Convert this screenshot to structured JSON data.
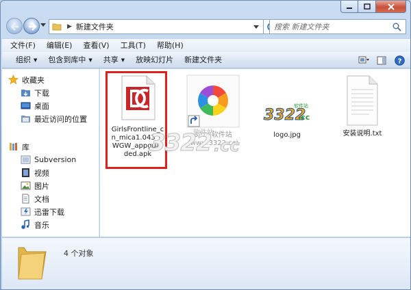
{
  "window": {
    "caption": {
      "minimize_icon": "minimize-icon",
      "maximize_icon": "maximize-icon",
      "close_icon": "close-icon"
    }
  },
  "address_bar": {
    "path": [
      "新建文件夹"
    ],
    "search_placeholder": "搜索 新建文件夹"
  },
  "menu": [
    "文件(F)",
    "编辑(E)",
    "查看(V)",
    "工具(T)",
    "帮助(H)"
  ],
  "toolbar": {
    "organize": "组织",
    "include_in_library": "包含到库中",
    "share": "共享",
    "slideshow": "放映幻灯片",
    "new_folder": "新建文件夹"
  },
  "nav": {
    "favorites": {
      "label": "收藏夹",
      "items": [
        "下载",
        "桌面",
        "最近访问的位置"
      ]
    },
    "libraries": {
      "label": "库",
      "items": [
        "Subversion",
        "视频",
        "图片",
        "文档",
        "迅雷下载",
        "音乐"
      ]
    }
  },
  "files": [
    {
      "name": "GirlsFrontline_cn_mica1.043_GWGW_appguarded.apk",
      "lines": [
        "GirlsFrontline_c",
        "n_mica1.043_G",
        "WGW_appguar",
        "ded.apk"
      ],
      "type": "apk",
      "selected": true
    },
    {
      "name": "3322软件站 (www.3322.cc)",
      "type": "shortcut"
    },
    {
      "name": "logo.jpg",
      "type": "image"
    },
    {
      "name": "安装说明.txt",
      "type": "text"
    }
  ],
  "shortcut_label_lines": [
    "3322软件站",
    "(www.3322.cc)"
  ],
  "watermark": {
    "big": "3322",
    "small": "软件站",
    "cc": ".cc"
  },
  "logo": {
    "text": "3322",
    "cc": ".cc",
    "tag": "软件站"
  },
  "details": {
    "status": "4 个对象"
  },
  "colors": {
    "highlight": "#e0201c",
    "apk_red": "#c8262b",
    "accent": "#1e5fa8"
  }
}
